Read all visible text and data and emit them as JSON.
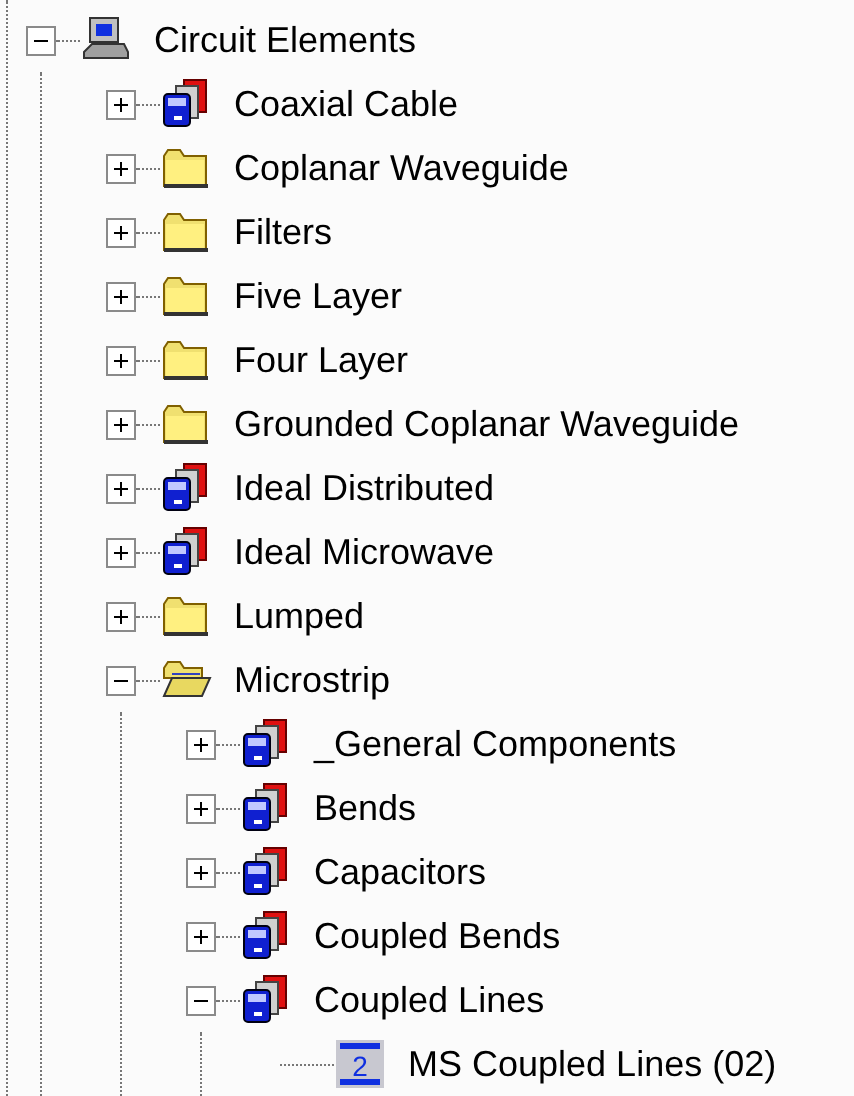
{
  "tree": {
    "label": "Circuit Elements",
    "kind": "computer",
    "expanded": true,
    "children": [
      {
        "label": "Coaxial Cable",
        "kind": "stack",
        "expanded": false
      },
      {
        "label": "Coplanar Waveguide",
        "kind": "folder",
        "expanded": false
      },
      {
        "label": "Filters",
        "kind": "folder",
        "expanded": false
      },
      {
        "label": "Five Layer",
        "kind": "folder",
        "expanded": false
      },
      {
        "label": "Four Layer",
        "kind": "folder",
        "expanded": false
      },
      {
        "label": "Grounded Coplanar Waveguide",
        "kind": "folder",
        "expanded": false
      },
      {
        "label": "Ideal Distributed",
        "kind": "stack",
        "expanded": false
      },
      {
        "label": "Ideal Microwave",
        "kind": "stack",
        "expanded": false
      },
      {
        "label": "Lumped",
        "kind": "folder",
        "expanded": false
      },
      {
        "label": "Microstrip",
        "kind": "openfolder",
        "expanded": true,
        "children": [
          {
            "label": "_General Components",
            "kind": "stack",
            "expanded": false
          },
          {
            "label": "Bends",
            "kind": "stack",
            "expanded": false
          },
          {
            "label": "Capacitors",
            "kind": "stack",
            "expanded": false
          },
          {
            "label": "Coupled Bends",
            "kind": "stack",
            "expanded": false
          },
          {
            "label": "Coupled Lines",
            "kind": "stack",
            "expanded": true,
            "children": [
              {
                "label": "MS Coupled Lines (02)",
                "kind": "component",
                "badge": "2"
              }
            ]
          }
        ]
      }
    ]
  }
}
